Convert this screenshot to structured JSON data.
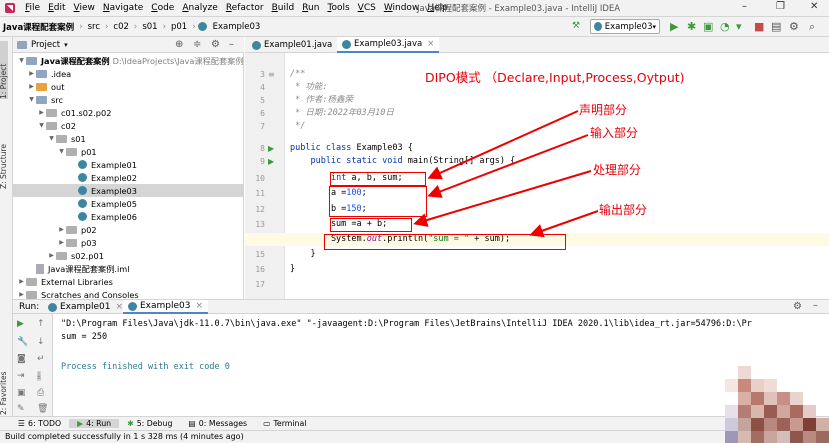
{
  "menu": [
    "File",
    "Edit",
    "View",
    "Navigate",
    "Code",
    "Analyze",
    "Refactor",
    "Build",
    "Run",
    "Tools",
    "VCS",
    "Window",
    "Help"
  ],
  "window_title": "Java课程配套案例 - Example03.java - IntelliJ IDEA",
  "breadcrumbs": [
    "Java课程配套案例",
    "src",
    "c02",
    "s01",
    "p01",
    "Example03"
  ],
  "run_config": "Example03",
  "side_labels": {
    "project": "1: Project",
    "structure": "Z: Structure",
    "favorites": "2: Favorites"
  },
  "project_panel": {
    "title": "Project"
  },
  "tree": [
    {
      "label": "Java课程配套案例",
      "path": "D:\\IdeaProjects\\Java课程配套案例",
      "bold": true
    },
    {
      "label": ".idea"
    },
    {
      "label": "out"
    },
    {
      "label": "src"
    },
    {
      "label": "c01.s02.p02"
    },
    {
      "label": "c02"
    },
    {
      "label": "s01"
    },
    {
      "label": "p01"
    },
    {
      "label": "Example01"
    },
    {
      "label": "Example02"
    },
    {
      "label": "Example03"
    },
    {
      "label": "Example05"
    },
    {
      "label": "Example06"
    },
    {
      "label": "p02"
    },
    {
      "label": "p03"
    },
    {
      "label": "s02.p01"
    },
    {
      "label": "Java课程配套案例.iml"
    },
    {
      "label": "External Libraries"
    },
    {
      "label": "Scratches and Consoles"
    }
  ],
  "editor_tabs": [
    "Example01.java",
    "Example03.java"
  ],
  "line_numbers": [
    "3",
    "4",
    "5",
    "6",
    "7",
    "8",
    "9",
    "10",
    "11",
    "12",
    "13",
    "14",
    "15",
    "16",
    "17"
  ],
  "annotations": {
    "title": "DIPO模式 （Declare,Input,Process,Oytput)",
    "declare": "声明部分",
    "input": "输入部分",
    "process": "处理部分",
    "output": "输出部分"
  },
  "run_panel": {
    "label": "Run:",
    "tabs": [
      "Example01",
      "Example03"
    ],
    "output": [
      "\"D:\\Program Files\\Java\\jdk-11.0.7\\bin\\java.exe\" \"-javaagent:D:\\Program Files\\JetBrains\\IntelliJ IDEA 2020.1\\lib\\idea_rt.jar=54796:D:\\Pr",
      "sum = 250",
      "",
      "Process finished with exit code 0"
    ]
  },
  "bottom_tabs": [
    "6: TODO",
    "4: Run",
    "5: Debug",
    "0: Messages",
    "Terminal"
  ],
  "status": "Build completed successfully in 1 s 328 ms (4 minutes ago)"
}
